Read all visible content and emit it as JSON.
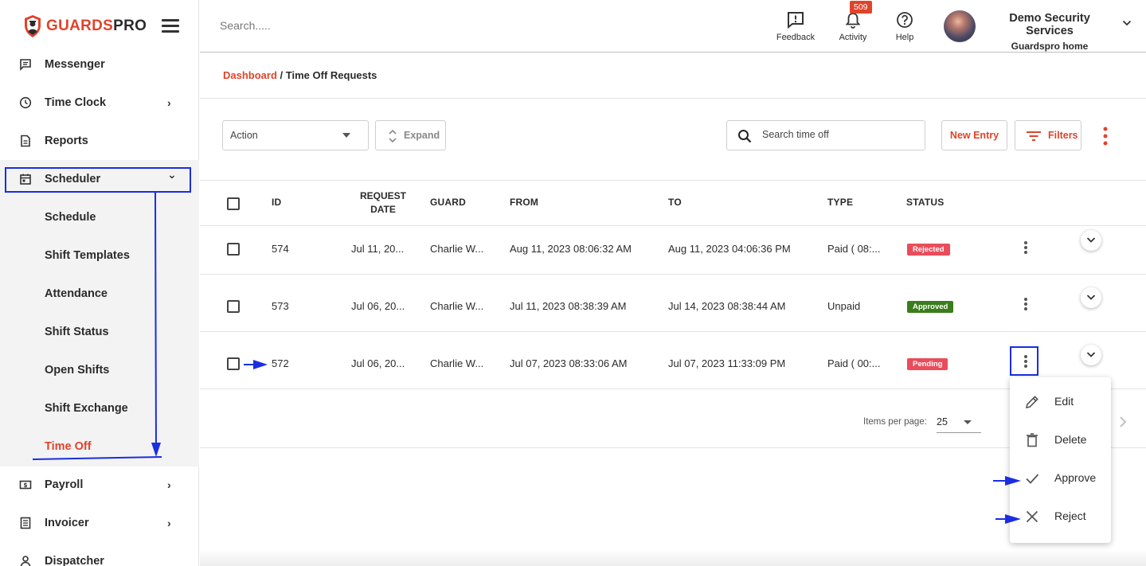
{
  "brand": {
    "guards": "GUARDS",
    "pro": "PRO"
  },
  "sidebar": {
    "items": [
      {
        "label": "Messenger"
      },
      {
        "label": "Time Clock",
        "chevron": "›"
      },
      {
        "label": "Reports"
      },
      {
        "label": "Scheduler",
        "chevron": "⌄"
      },
      {
        "label": "Payroll",
        "chevron": "›"
      },
      {
        "label": "Invoicer",
        "chevron": "›"
      },
      {
        "label": "Dispatcher"
      }
    ],
    "subitems": [
      {
        "label": "Schedule"
      },
      {
        "label": "Shift Templates"
      },
      {
        "label": "Attendance"
      },
      {
        "label": "Shift Status"
      },
      {
        "label": "Open Shifts"
      },
      {
        "label": "Shift Exchange"
      },
      {
        "label": "Time Off",
        "active": true
      }
    ]
  },
  "topbar": {
    "search_placeholder": "Search.....",
    "feedback": "Feedback",
    "activity": "Activity",
    "activity_badge": "509",
    "help": "Help",
    "company_name": "Demo Security Services",
    "company_sub": "Guardspro home"
  },
  "breadcrumb": {
    "link": "Dashboard",
    "sep": "/",
    "current": "Time Off Requests"
  },
  "toolbar": {
    "action": "Action",
    "expand": "Expand",
    "search_placeholder": "Search time off",
    "new_entry": "New Entry",
    "filters": "Filters"
  },
  "table": {
    "headers": {
      "id": "ID",
      "request_date": "REQUEST DATE",
      "guard": "GUARD",
      "from": "FROM",
      "to": "TO",
      "type": "TYPE",
      "status": "STATUS"
    },
    "rows": [
      {
        "id": "574",
        "request_date": "Jul 11, 20...",
        "guard": "Charlie W...",
        "from": "Aug 11, 2023 08:06:32 AM",
        "to": "Aug 11, 2023 04:06:36 PM",
        "type": "Paid ( 08:...",
        "status": "Rejected"
      },
      {
        "id": "573",
        "request_date": "Jul 06, 20...",
        "guard": "Charlie W...",
        "from": "Jul 11, 2023 08:38:39 AM",
        "to": "Jul 14, 2023 08:38:44 AM",
        "type": "Unpaid",
        "status": "Approved"
      },
      {
        "id": "572",
        "request_date": "Jul 06, 20...",
        "guard": "Charlie W...",
        "from": "Jul 07, 2023 08:33:06 AM",
        "to": "Jul 07, 2023 11:33:09 PM",
        "type": "Paid ( 00:...",
        "status": "Pending"
      }
    ]
  },
  "pagination": {
    "label": "Items per page:",
    "value": "25"
  },
  "menu": {
    "edit": "Edit",
    "delete": "Delete",
    "approve": "Approve",
    "reject": "Reject"
  },
  "colors": {
    "accent": "#e0432b",
    "annotation": "#1a2ee0",
    "rejected": "#e94c5b",
    "approved": "#3a7d1a",
    "pending": "#e94c5b"
  }
}
